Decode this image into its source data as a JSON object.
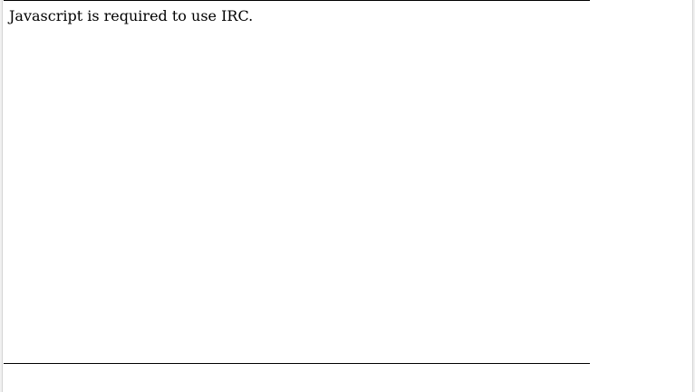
{
  "notice": {
    "text": "Javascript is required to use IRC."
  }
}
